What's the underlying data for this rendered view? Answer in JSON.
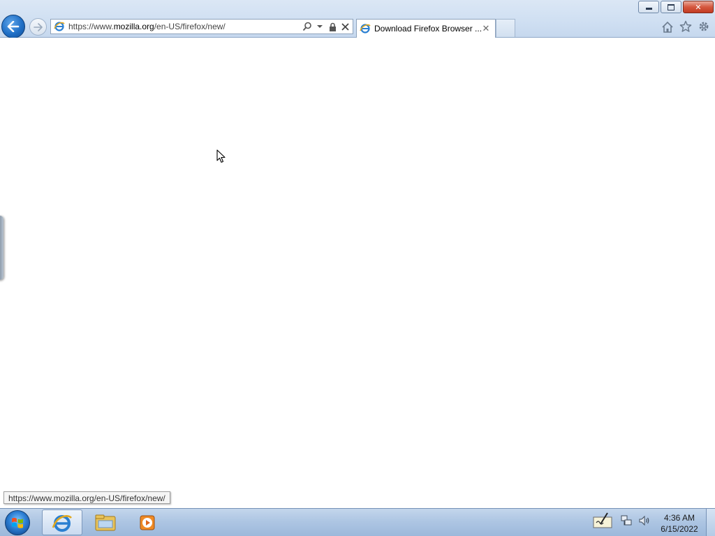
{
  "window": {
    "minimize_label": "minimize",
    "maximize_label": "restore",
    "close_label": "✕"
  },
  "navigation": {
    "back_icon": "back-arrow-icon",
    "forward_icon": "forward-arrow-icon"
  },
  "address_bar": {
    "url_prefix": "https://www.",
    "url_host": "mozilla.org",
    "url_path": "/en-US/firefox/new/",
    "icons": [
      "search-icon",
      "dropdown-icon",
      "lock-icon",
      "stop-icon"
    ]
  },
  "tabs": [
    {
      "title": "Download Firefox Browser ...",
      "close": "✕"
    }
  ],
  "toolbar_right": [
    "home-icon",
    "favorites-star-icon",
    "settings-gear-icon"
  ],
  "status_bar": {
    "hover_url": "https://www.mozilla.org/en-US/firefox/new/"
  },
  "taskbar": {
    "pinned": [
      "internet-explorer-icon",
      "file-explorer-icon",
      "media-player-icon"
    ],
    "tray_icons": [
      "action-center-icon",
      "network-icon",
      "volume-icon"
    ],
    "clock_time": "4:36 AM",
    "clock_date": "6/15/2022"
  },
  "colors": {
    "titlebar": "#cfdff2",
    "taskbar": "#aec6e3",
    "close_button": "#c23b22",
    "back_button": "#1f6fc6"
  }
}
